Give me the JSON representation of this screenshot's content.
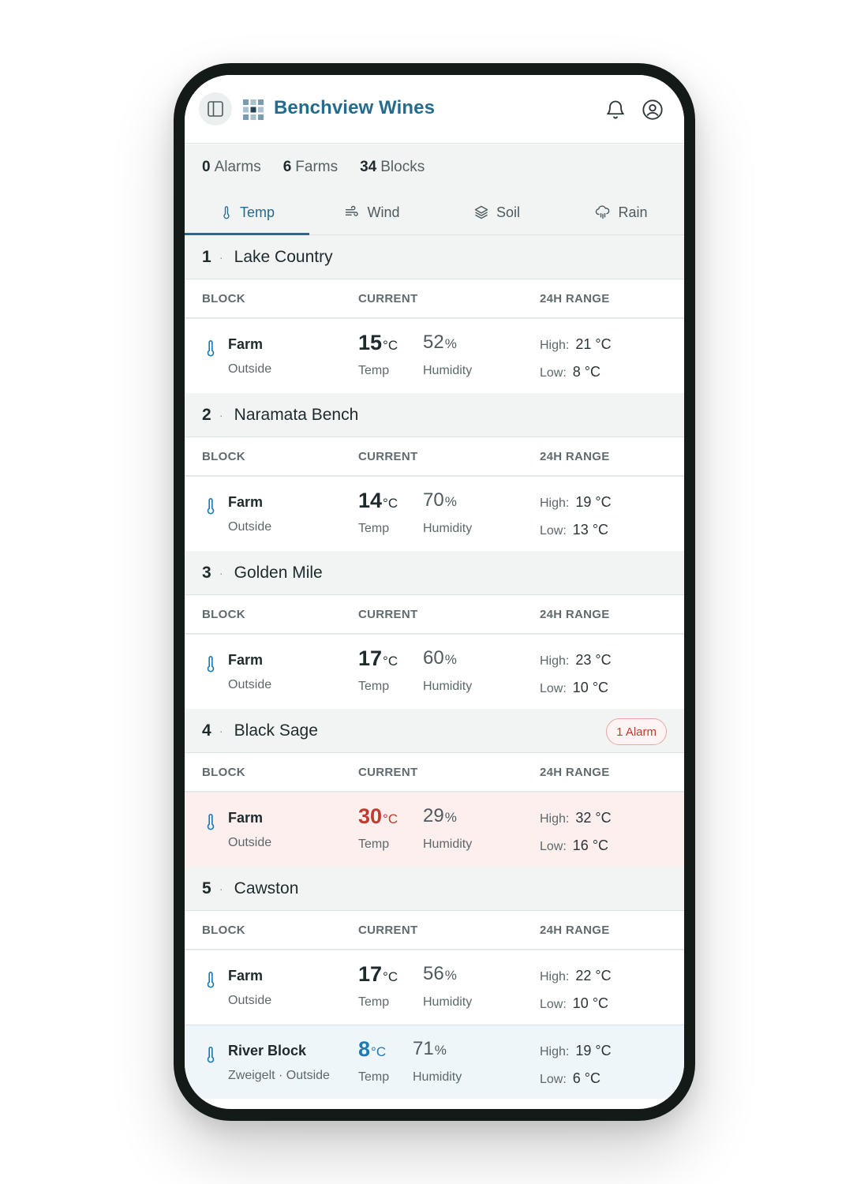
{
  "app": {
    "title": "Benchview Wines"
  },
  "summary": [
    {
      "count": "0",
      "label": "Alarms"
    },
    {
      "count": "6",
      "label": "Farms"
    },
    {
      "count": "34",
      "label": "Blocks"
    }
  ],
  "tabs": [
    {
      "label": "Temp",
      "icon": "thermometer-icon",
      "active": true
    },
    {
      "label": "Wind",
      "icon": "wind-icon",
      "active": false
    },
    {
      "label": "Soil",
      "icon": "layers-icon",
      "active": false
    },
    {
      "label": "Rain",
      "icon": "rain-cloud-icon",
      "active": false
    }
  ],
  "columns": {
    "block": "BLOCK",
    "current": "CURRENT",
    "range": "24H RANGE"
  },
  "labels": {
    "temp": "Temp",
    "humidity": "Humidity",
    "high": "High:",
    "low": "Low:",
    "temp_unit": "°C",
    "hum_unit": "%"
  },
  "farms": [
    {
      "num": "1",
      "dot": "·",
      "name": "Lake Country",
      "alarm": "",
      "blocks": [
        {
          "name": "Farm",
          "sub": "Outside",
          "temp": "15",
          "humidity": "52",
          "high": "21 °C",
          "low": "8 °C",
          "state": "normal"
        }
      ]
    },
    {
      "num": "2",
      "dot": "·",
      "name": "Naramata Bench",
      "alarm": "",
      "blocks": [
        {
          "name": "Farm",
          "sub": "Outside",
          "temp": "14",
          "humidity": "70",
          "high": "19 °C",
          "low": "13 °C",
          "state": "normal"
        }
      ]
    },
    {
      "num": "3",
      "dot": "·",
      "name": "Golden Mile",
      "alarm": "",
      "blocks": [
        {
          "name": "Farm",
          "sub": "Outside",
          "temp": "17",
          "humidity": "60",
          "high": "23 °C",
          "low": "10 °C",
          "state": "normal"
        }
      ]
    },
    {
      "num": "4",
      "dot": "·",
      "name": "Black Sage",
      "alarm": "1 Alarm",
      "blocks": [
        {
          "name": "Farm",
          "sub": "Outside",
          "temp": "30",
          "humidity": "29",
          "high": "32 °C",
          "low": "16 °C",
          "state": "alarm"
        }
      ]
    },
    {
      "num": "5",
      "dot": "·",
      "name": "Cawston",
      "alarm": "",
      "blocks": [
        {
          "name": "Farm",
          "sub": "Outside",
          "temp": "17",
          "humidity": "56",
          "high": "22 °C",
          "low": "10 °C",
          "state": "normal"
        },
        {
          "name": "River Block",
          "sub": "Zweigelt · Outside",
          "temp": "8",
          "humidity": "71",
          "high": "19 °C",
          "low": "6 °C",
          "state": "highlight"
        }
      ]
    }
  ],
  "colors": {
    "accent": "#246b8e",
    "alarm": "#c03b2f",
    "cold": "#1f7bb4",
    "alarm_row_bg": "#fcefee",
    "highlight_row_bg": "#eef6fa"
  }
}
